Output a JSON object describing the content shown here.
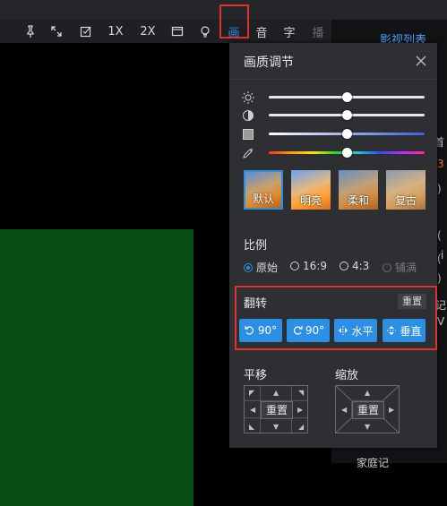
{
  "toolbar": {
    "items": [
      {
        "label": "",
        "icon": "pin-icon"
      },
      {
        "label": "",
        "icon": "fullscreen-icon"
      },
      {
        "label": "",
        "icon": "checkbox-icon"
      },
      {
        "label": "1X"
      },
      {
        "label": "2X"
      },
      {
        "label": "",
        "icon": "window-icon"
      },
      {
        "label": "",
        "icon": "bulb-icon"
      },
      {
        "label": "画"
      },
      {
        "label": "音"
      },
      {
        "label": "字"
      },
      {
        "label": "播"
      }
    ],
    "active_index": 7
  },
  "right_panel": {
    "title": "影视列表",
    "fragments": [
      "首",
      "3",
      ")",
      "(",
      "i",
      "(",
      ")",
      "记",
      "V",
      "·",
      "家庭记"
    ]
  },
  "panel": {
    "title": "画质调节",
    "sliders": [
      {
        "name": "brightness",
        "icon": "brightness-icon",
        "value": 0.5
      },
      {
        "name": "contrast",
        "icon": "contrast-icon",
        "value": 0.5
      },
      {
        "name": "saturation",
        "icon": "saturation-icon",
        "value": 0.5
      },
      {
        "name": "hue",
        "icon": "eyedropper-icon",
        "value": 0.5
      }
    ],
    "presets": [
      {
        "label": "默认",
        "selected": true
      },
      {
        "label": "明亮",
        "selected": false
      },
      {
        "label": "柔和",
        "selected": false
      },
      {
        "label": "复古",
        "selected": false
      }
    ],
    "ratio": {
      "label": "比例",
      "options": [
        {
          "label": "原始",
          "selected": true,
          "disabled": false
        },
        {
          "label": "16:9",
          "selected": false,
          "disabled": false
        },
        {
          "label": "4:3",
          "selected": false,
          "disabled": false
        },
        {
          "label": "铺满",
          "selected": false,
          "disabled": true
        }
      ]
    },
    "flip": {
      "label": "翻转",
      "reset_label": "重置",
      "buttons": [
        {
          "label": "90°",
          "icon": "rotate-left-icon"
        },
        {
          "label": "90°",
          "icon": "rotate-right-icon"
        },
        {
          "label": "水平",
          "icon": "flip-horizontal-icon"
        },
        {
          "label": "垂直",
          "icon": "flip-vertical-icon"
        }
      ]
    },
    "pan": {
      "label": "平移",
      "reset_label": "重置"
    },
    "zoom": {
      "label": "缩放",
      "reset_label": "重置"
    }
  },
  "colors": {
    "accent": "#2b8fe6",
    "highlight": "#e0302a",
    "panel_bg": "#2d2f33"
  }
}
